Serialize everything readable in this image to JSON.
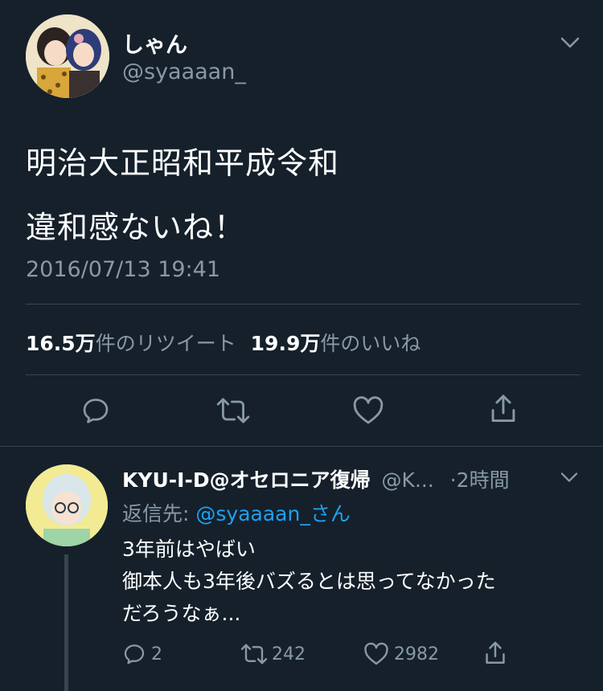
{
  "tweet": {
    "author": {
      "name": "しゃん",
      "handle": "@syaaaan_"
    },
    "text_lines": [
      "明治大正昭和平成令和",
      "違和感ないね！"
    ],
    "timestamp": "2016/07/13 19:41",
    "stats": {
      "retweets_value": "16.5万",
      "retweets_label": "件のリツイート",
      "likes_value": "19.9万",
      "likes_label": "件のいいね"
    }
  },
  "reply": {
    "author": {
      "name": "KYU-I-D@オセロニア復帰",
      "handle": "@K...",
      "time": "·2時間"
    },
    "reply_to_label": "返信先:",
    "reply_to_handle": "@syaaaan_さん",
    "text_lines": [
      "3年前はやばい",
      "御本人も3年後バズるとは思ってなかった",
      "だろうなぁ..."
    ],
    "counts": {
      "replies": "2",
      "retweets": "242",
      "likes": "2982"
    }
  },
  "colors": {
    "background": "#15202b",
    "text": "#ffffff",
    "muted": "#8899a6",
    "accent": "#1da1f2",
    "divider": "#38444d"
  },
  "icons": [
    "chevron-down-icon",
    "reply-icon",
    "retweet-icon",
    "like-icon",
    "share-icon"
  ]
}
